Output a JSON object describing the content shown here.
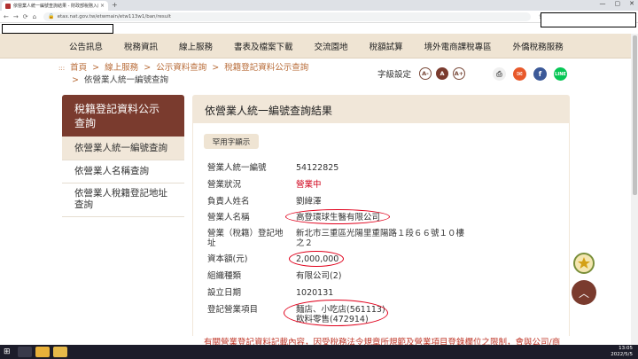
{
  "browser": {
    "tab_title": "依營業人統一編號查詢結果 - 財政部稅務入口網",
    "tab_close": "×",
    "new_tab": "+",
    "url": "etax.nat.gov.tw/etwmain/etw113w1/ban/result",
    "controls": {
      "minimize": "—",
      "maximize": "▢",
      "close": "✕"
    },
    "nav": {
      "back": "←",
      "forward": "→",
      "reload": "⟳",
      "home": "⌂"
    }
  },
  "menu": {
    "items": [
      "公告訊息",
      "稅務資訊",
      "線上服務",
      "書表及檔案下載",
      "交流園地",
      "稅額試算",
      "境外電商課稅專區",
      "外僑稅務服務"
    ]
  },
  "breadcrumb": {
    "dots": ":::",
    "items": [
      "首頁",
      "線上服務",
      "公示資料查詢",
      "稅籍登記資料公示查詢"
    ],
    "current": "依營業人統一編號查詢",
    "sep": ">"
  },
  "font_control": {
    "label": "字級設定",
    "small": "A-",
    "normal": "A",
    "large": "A+"
  },
  "share": {
    "print": "⎙",
    "mail": "✉",
    "facebook": "f",
    "line": "LINE"
  },
  "sidebar": {
    "title_line1": "稅籍登記資料公示",
    "title_line2": "查詢",
    "items": [
      {
        "label": "依營業人統一編號查詢"
      },
      {
        "label": "依營業人名稱查詢"
      },
      {
        "label_line1": "依營業人稅籍登記地址",
        "label_line2": "查詢"
      }
    ]
  },
  "main": {
    "title": "依營業人統一編號查詢結果",
    "common_font_button": "罕用字顯示",
    "fields": {
      "ban_label": "營業人統一編號",
      "ban_value": "54122825",
      "status_label": "營業狀況",
      "status_value": "營業中",
      "owner_label": "負責人姓名",
      "owner_value": "劉緯澤",
      "name_label": "營業人名稱",
      "name_value": "高登環球生醫有限公司",
      "address_label_1": "營業（稅籍）登記地",
      "address_label_2": "址",
      "address_value_1": "新北市三重區光陽里重陽路１段６６號１０樓",
      "address_value_2": "之２",
      "capital_label": "資本額(元)",
      "capital_value": "2,000,000",
      "org_label": "組織種類",
      "org_value": "有限公司(2)",
      "date_label": "設立日期",
      "date_value": "1020131",
      "items_label": "登記營業項目",
      "items_value_1": "麵店、小吃店(561113)",
      "items_value_2": "飲料零售(472914)"
    },
    "notice": "有關營業登記資料記載內容，因受稅務法令規章所規範及營業項目登錄欄位之限制，會與公司/商"
  },
  "float": {
    "to_top": "︿"
  },
  "taskbar": {
    "time": "13:05",
    "date": "2022/5/5",
    "start": "⊞"
  }
}
